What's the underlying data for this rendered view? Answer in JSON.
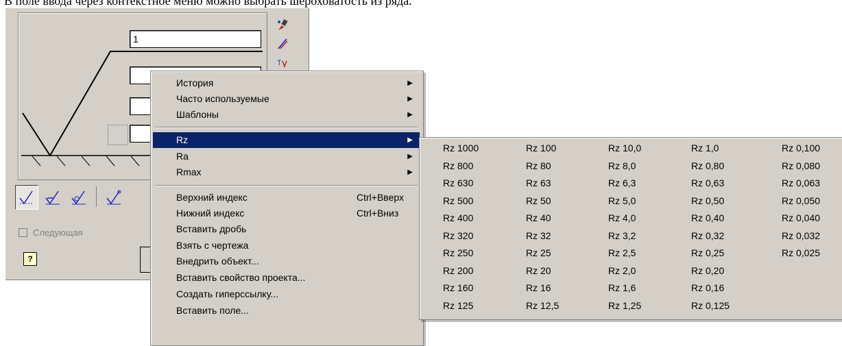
{
  "caption": "В поле ввода через контекстное меню можно выбрать шероховатость из ряда.",
  "dialog": {
    "field1_value": "1",
    "field2_value": "",
    "field3_value": "",
    "field4_value": "",
    "next_label": "Следующая",
    "help_label": "?",
    "side_icons": [
      "brush-icon",
      "pen-icon",
      "format-icon"
    ],
    "toolbar_icons": [
      "roughness-basic-icon",
      "roughness-removal-icon",
      "roughness-noremoval-icon",
      "roughness-leader-icon"
    ]
  },
  "context_menu": {
    "items": [
      {
        "label": "История",
        "submenu": true
      },
      {
        "label": "Часто используемые",
        "submenu": true
      },
      {
        "label": "Шаблоны",
        "submenu": true
      },
      {
        "label": "Rz",
        "submenu": true,
        "selected": true
      },
      {
        "label": "Ra",
        "submenu": true
      },
      {
        "label": "Rmax",
        "submenu": true
      },
      {
        "label": "Верхний индекс",
        "shortcut": "Ctrl+Вверх"
      },
      {
        "label": "Нижний индекс",
        "shortcut": "Ctrl+Вниз"
      },
      {
        "label": "Вставить дробь"
      },
      {
        "label": "Взять с чертежа"
      },
      {
        "label": "Внедрить объект..."
      },
      {
        "label": "Вставить свойство проекта..."
      },
      {
        "label": "Создать гиперссылку..."
      },
      {
        "label": "Вставить поле..."
      }
    ]
  },
  "rz_submenu": {
    "columns": [
      [
        "Rz 1000",
        "Rz 800",
        "Rz 630",
        "Rz 500",
        "Rz 400",
        "Rz 320",
        "Rz 250",
        "Rz 200",
        "Rz 160",
        "Rz 125"
      ],
      [
        "Rz 100",
        "Rz 80",
        "Rz 63",
        "Rz 50",
        "Rz 40",
        "Rz 32",
        "Rz 25",
        "Rz 20",
        "Rz 16",
        "Rz 12,5"
      ],
      [
        "Rz 10,0",
        "Rz 8,0",
        "Rz 6,3",
        "Rz 5,0",
        "Rz 4,0",
        "Rz 3,2",
        "Rz 2,5",
        "Rz 2,0",
        "Rz 1,6",
        "Rz 1,25"
      ],
      [
        "Rz 1,0",
        "Rz 0,80",
        "Rz 0,63",
        "Rz 0,50",
        "Rz 0,40",
        "Rz 0,32",
        "Rz 0,25",
        "Rz 0,20",
        "Rz 0,16",
        "Rz 0,125"
      ],
      [
        "Rz 0,100",
        "Rz 0,080",
        "Rz 0,063",
        "Rz 0,050",
        "Rz 0,040",
        "Rz 0,032",
        "Rz 0,025"
      ]
    ]
  },
  "colors": {
    "selection": "#0a246a",
    "face": "#d4d0c8"
  }
}
